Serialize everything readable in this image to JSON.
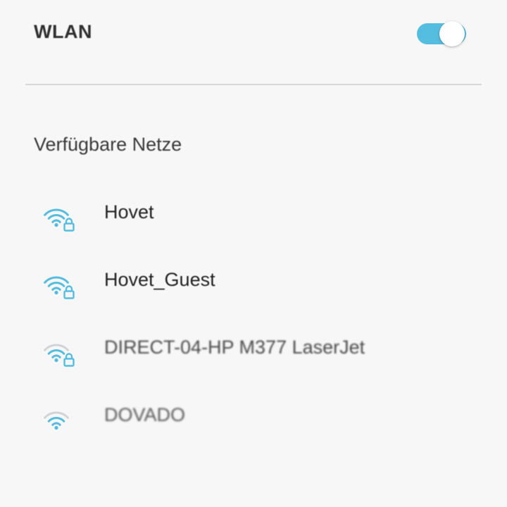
{
  "wlan": {
    "title": "WLAN",
    "enabled": true
  },
  "colors": {
    "accent": "#55bde0",
    "icon_dim": "#cfd4d6",
    "background": "#f7f7f7"
  },
  "section": {
    "label": "Verfügbare Netze"
  },
  "networks": [
    {
      "name": "Hovet",
      "locked": true,
      "signal_bars": 3,
      "icon": "wifi-lock-icon"
    },
    {
      "name": "Hovet_Guest",
      "locked": true,
      "signal_bars": 3,
      "icon": "wifi-lock-icon"
    },
    {
      "name": "DIRECT-04-HP M377 LaserJet",
      "locked": true,
      "signal_bars": 2,
      "icon": "wifi-lock-icon"
    },
    {
      "name": "DOVADO",
      "locked": false,
      "signal_bars": 2,
      "icon": "wifi-icon"
    }
  ]
}
